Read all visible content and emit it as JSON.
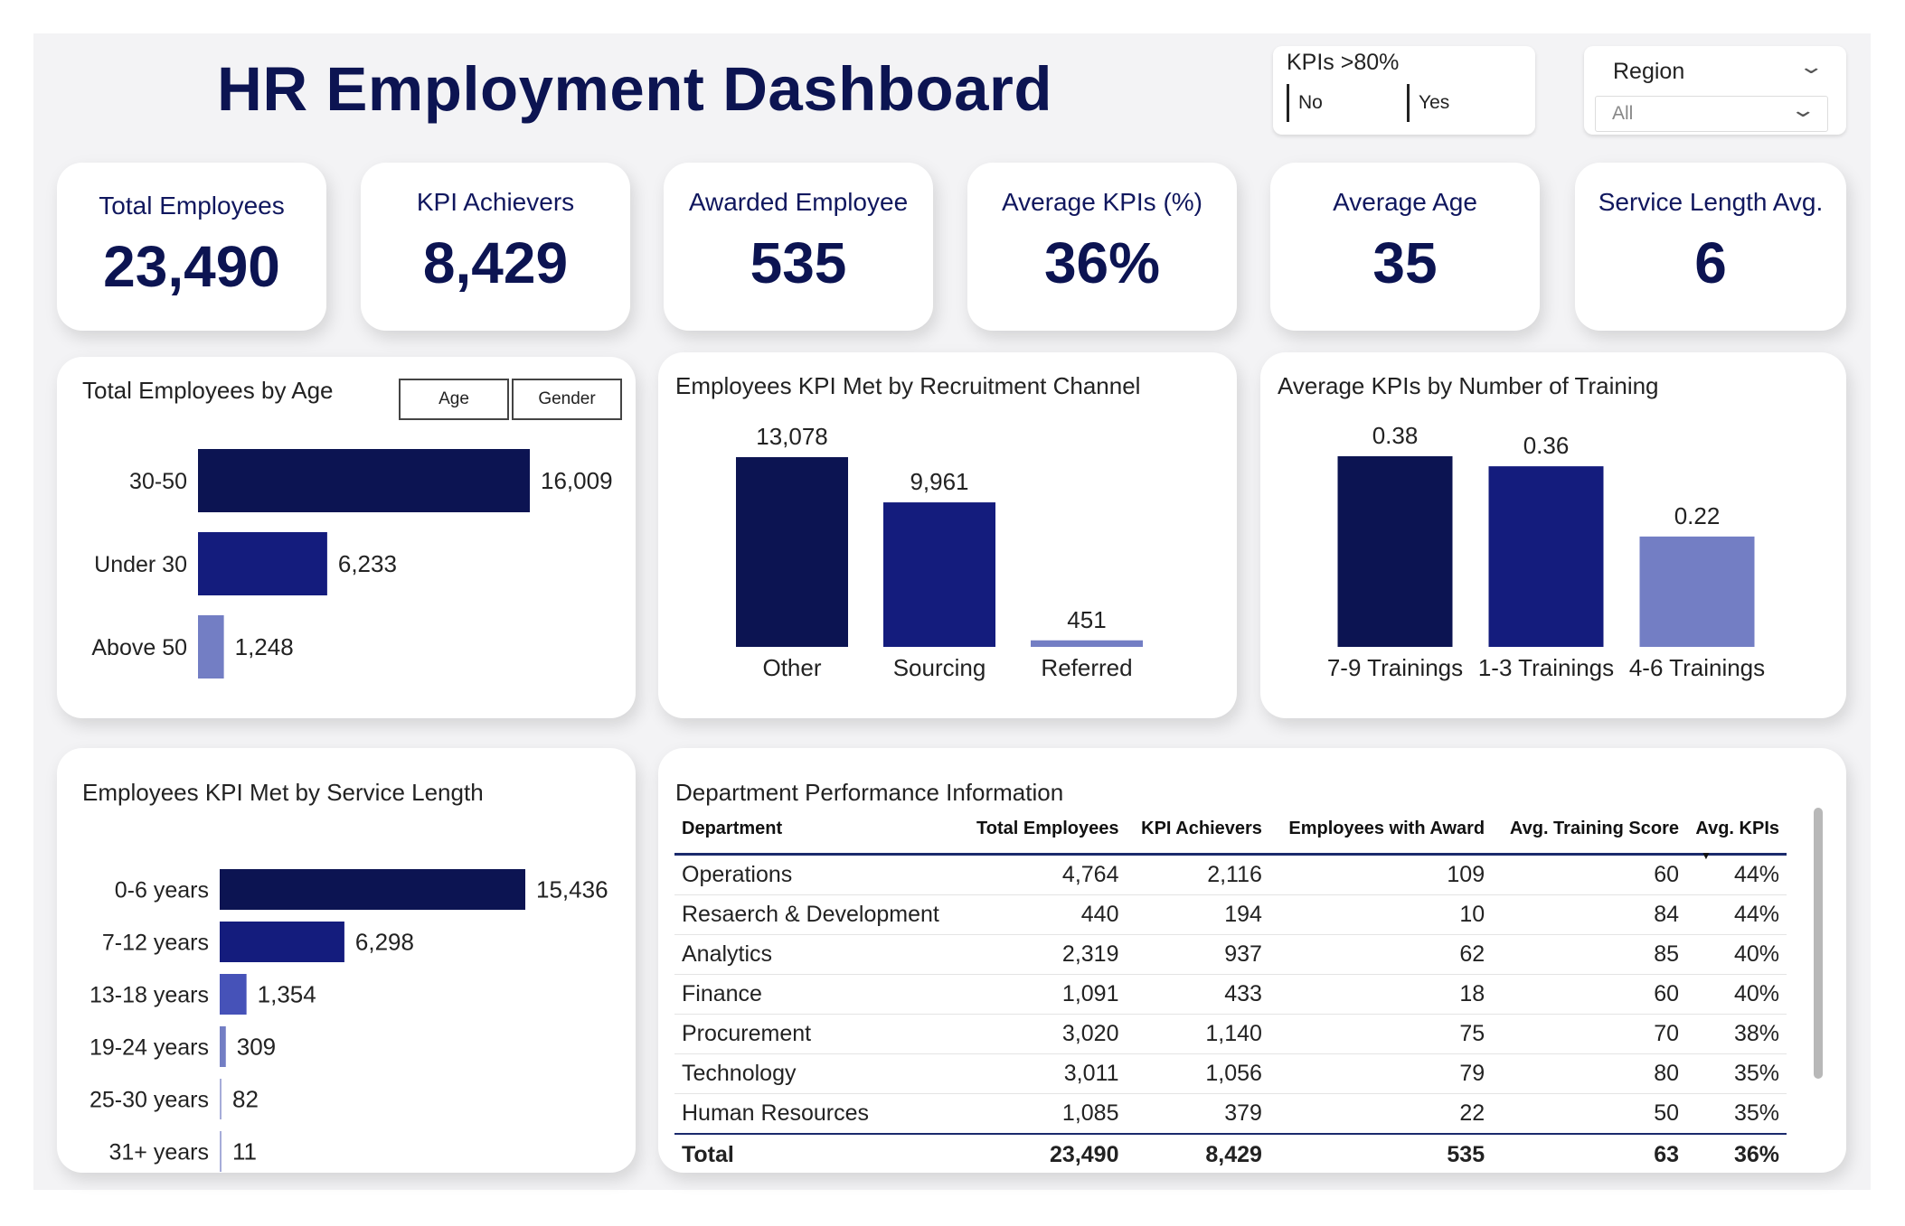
{
  "header": {
    "title": "HR Employment Dashboard"
  },
  "filters": {
    "kpi_slicer": {
      "label": "KPIs >80%",
      "options": [
        "No",
        "Yes"
      ]
    },
    "region_slicer": {
      "label": "Region",
      "selected": "All"
    }
  },
  "kpi_cards": [
    {
      "label": "Total Employees",
      "value": "23,490"
    },
    {
      "label": "KPI Achievers",
      "value": "8,429"
    },
    {
      "label": "Awarded Employee",
      "value": "535"
    },
    {
      "label": "Average KPIs (%)",
      "value": "36%"
    },
    {
      "label": "Average Age",
      "value": "35"
    },
    {
      "label": "Service Length Avg.",
      "value": "6"
    }
  ],
  "charts": {
    "age": {
      "title": "Total Employees by Age",
      "toggles": [
        "Age",
        "Gender"
      ]
    },
    "channel": {
      "title": "Employees KPI Met by Recruitment Channel"
    },
    "training": {
      "title": "Average KPIs by Number of Training"
    },
    "service": {
      "title": "Employees KPI Met by Service Length"
    }
  },
  "colors": {
    "dark": "#0c1452",
    "mid": "#141c7d",
    "medium": "#4652b8",
    "light": "#737ec4",
    "lightest": "#a6acd9"
  },
  "chart_data": [
    {
      "id": "age",
      "type": "bar",
      "orientation": "horizontal",
      "title": "Total Employees by Age",
      "categories": [
        "30-50",
        "Under 30",
        "Above 50"
      ],
      "values": [
        16009,
        6233,
        1248
      ],
      "labels": [
        "16,009",
        "6,233",
        "1,248"
      ]
    },
    {
      "id": "channel",
      "type": "bar",
      "title": "Employees KPI Met by Recruitment Channel",
      "categories": [
        "Other",
        "Sourcing",
        "Referred"
      ],
      "values": [
        13078,
        9961,
        451
      ],
      "labels": [
        "13,078",
        "9,961",
        "451"
      ]
    },
    {
      "id": "training",
      "type": "bar",
      "title": "Average KPIs by Number of Training",
      "categories": [
        "7-9 Trainings",
        "1-3 Trainings",
        "4-6 Trainings"
      ],
      "values": [
        0.38,
        0.36,
        0.22
      ],
      "labels": [
        "0.38",
        "0.36",
        "0.22"
      ]
    },
    {
      "id": "service",
      "type": "bar",
      "orientation": "horizontal",
      "title": "Employees KPI Met by Service Length",
      "categories": [
        "0-6 years",
        "7-12 years",
        "13-18 years",
        "19-24 years",
        "25-30 years",
        "31+ years"
      ],
      "values": [
        15436,
        6298,
        1354,
        309,
        82,
        11
      ],
      "labels": [
        "15,436",
        "6,298",
        "1,354",
        "309",
        "82",
        "11"
      ]
    }
  ],
  "table": {
    "title": "Department Performance Information",
    "columns": [
      "Department",
      "Total Employees",
      "KPI Achievers",
      "Employees with Award",
      "Avg. Training Score",
      "Avg. KPIs"
    ],
    "rows": [
      [
        "Operations",
        "4,764",
        "2,116",
        "109",
        "60",
        "44%"
      ],
      [
        "Resaerch & Development",
        "440",
        "194",
        "10",
        "84",
        "44%"
      ],
      [
        "Analytics",
        "2,319",
        "937",
        "62",
        "85",
        "40%"
      ],
      [
        "Finance",
        "1,091",
        "433",
        "18",
        "60",
        "40%"
      ],
      [
        "Procurement",
        "3,020",
        "1,140",
        "75",
        "70",
        "38%"
      ],
      [
        "Technology",
        "3,011",
        "1,056",
        "79",
        "80",
        "35%"
      ],
      [
        "Human Resources",
        "1,085",
        "379",
        "22",
        "50",
        "35%"
      ]
    ],
    "total": [
      "Total",
      "23,490",
      "8,429",
      "535",
      "63",
      "36%"
    ]
  }
}
